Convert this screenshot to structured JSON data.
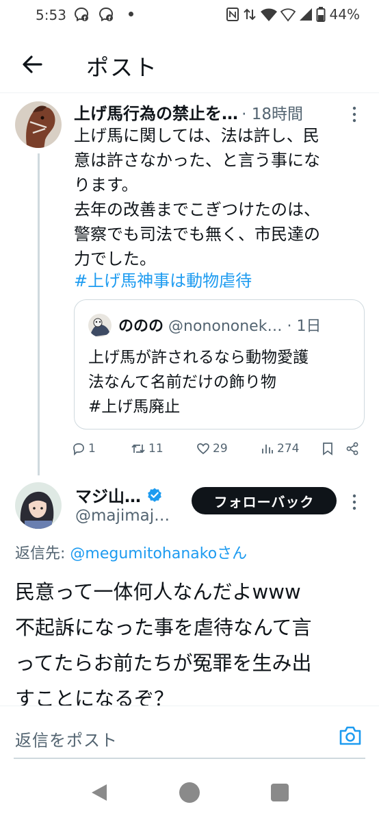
{
  "status_bar": {
    "time": "5:53",
    "notification_icons": [
      "facebook-messenger-icon",
      "facebook-messenger-icon"
    ],
    "battery_percent": "44%"
  },
  "header": {
    "title": "ポスト"
  },
  "tweet1": {
    "name": "上げ馬行為の禁止を…",
    "time": "· 18時間",
    "body": "上げ馬に関しては、法は許し、民\n意は許さなかった、と言う事にな\nります。\n去年の改善までこぎつけたのは、\n警察でも司法でも無く、市民達の\n力でした。",
    "hashtag": "#上げ馬神事は動物虐待",
    "quote": {
      "name": "ののの",
      "handle": "@nonononek…",
      "time": "· 1日",
      "body": "上げ馬が許されるなら動物愛護\n法なんて名前だけの飾り物\n#上げ馬廃止"
    },
    "actions": {
      "replies": "1",
      "reposts": "11",
      "likes": "29",
      "views": "274"
    }
  },
  "tweet2": {
    "name": "マジ山…",
    "handle": "@majimaj…",
    "follow_label": "フォローバック",
    "reply_prefix": "返信先: ",
    "reply_target": "@megumitohanakoさん",
    "body": "民意って一体何人なんだよwww\n不起訴になった事を虐待なんて言\nってたらお前たちが冤罪を生み出\nすことになるぞ？"
  },
  "composer": {
    "placeholder": "返信をポスト"
  },
  "colors": {
    "accent": "#1d9bf0",
    "text": "#0f1419",
    "muted": "#536471",
    "border": "#cfd9de"
  }
}
